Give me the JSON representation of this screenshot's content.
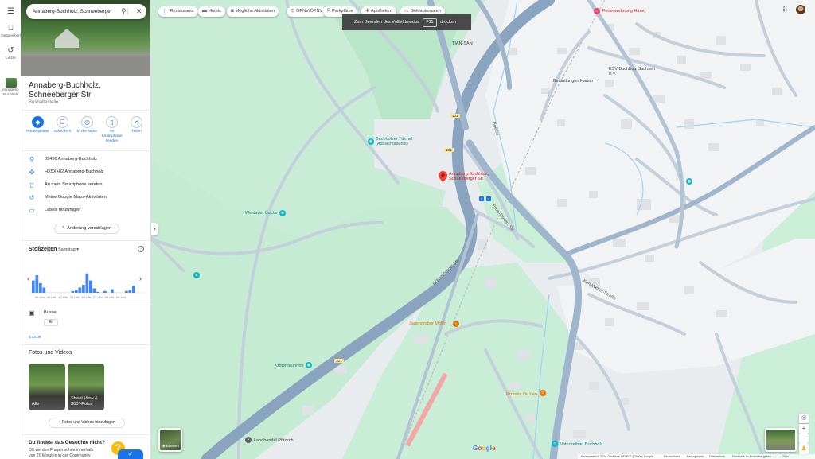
{
  "search": {
    "value": "Annaberg-Buchholz, Schneeberger St"
  },
  "rail": {
    "saved_label": "Gespeichert",
    "recent_label": "Letzte",
    "recent_place_line1": "Annaberg-",
    "recent_place_line2": "Buchholz"
  },
  "place": {
    "title": "Annaberg-Buchholz, Schneeberger Str",
    "category": "Bushaltestelle",
    "actions": [
      "Routenplaner",
      "Speichern",
      "In der Nähe",
      "An Smartphone senden",
      "Teilen"
    ],
    "address": "09456 Annaberg-Buchholz",
    "plus_code": "HX5X+82 Annaberg-Buchholz",
    "send_to_phone": "An mein Smartphone senden",
    "activity": "Meine Google Maps-Aktivitäten",
    "add_label": "Labels hinzufügen",
    "suggest_edit": "Änderung vorschlagen"
  },
  "popular_times": {
    "title": "Stoßzeiten",
    "day": "Samstag",
    "hour_labels": [
      "06 Uhr",
      "09 Uhr",
      "12 Uhr",
      "15 Uhr",
      "18 Uhr",
      "21 Uhr",
      "00 Uhr",
      "03 Uhr"
    ],
    "bars": [
      0.7,
      1.0,
      0.55,
      0.3,
      0,
      0,
      0,
      0,
      0,
      0,
      0,
      0.1,
      0.15,
      0.3,
      0.45,
      1.1,
      0.7,
      0.25,
      0.05,
      0,
      0.1,
      0,
      0.2,
      0,
      0,
      0,
      0.1,
      0.15,
      0.4
    ]
  },
  "transit": {
    "label": "Busse",
    "line": "E",
    "time": "1:44:09"
  },
  "photos": {
    "title": "Fotos und Videos",
    "items": [
      "Alle",
      "Street View & 360°-Fotos"
    ],
    "add": "Fotos und Videos hinzufügen"
  },
  "qa": {
    "title": "Du findest das Gesuchte nicht?",
    "text": "Oft werden Fragen schon innerhalb von 20 Minuten in der Community"
  },
  "chips": [
    "Restaurants",
    "Hotels",
    "Mögliche Aktivitäten",
    "ÖPNV/ÖPNV",
    "Parkplätze",
    "Apotheken",
    "Geldautomaten"
  ],
  "fullscreen": {
    "before": "Zum Beenden des Vollbildmodus",
    "key": "F11",
    "after": "drücken"
  },
  "map_labels": {
    "pin": "Annaberg-Buchholz, Schneeberger Str",
    "ferienwohnung": "Ferienwohnung Hänel",
    "tian_san": "TIAN-SAN",
    "esv": "ESV Buchholz Sachsen e.V.",
    "bestattungen": "Bestattungen Harzer",
    "turm": "Buchholzer Türmel (Aussichtspunkt)",
    "weidauer": "Weidauer Buche",
    "jaeger": "Jauengrabor Mollin",
    "kroeten": "Krötenbrunnen",
    "pizzeria": "Pizzeria Da Leo",
    "landhandel": "Landhandel Pfitzsch",
    "naturfreibad": "Naturfreibad Buchholz",
    "ernst": "Ernst-Rosetz-Str",
    "schneeberger": "Schneeberger Str.",
    "kurt": "Kurt-Weber-Straße",
    "goethe": "Goethe",
    "b101a": "101",
    "b101b": "101",
    "b101c": "101"
  },
  "controls": {
    "layers": "Ebenen"
  },
  "footer": [
    "Kartendaten © 2024 GeoBasis-DE/BKG (©2009) Google",
    "Deutschland",
    "Bedingungen",
    "Datenschutz",
    "Feedback zu Produkten geben",
    "20 m"
  ],
  "logo": "Google"
}
